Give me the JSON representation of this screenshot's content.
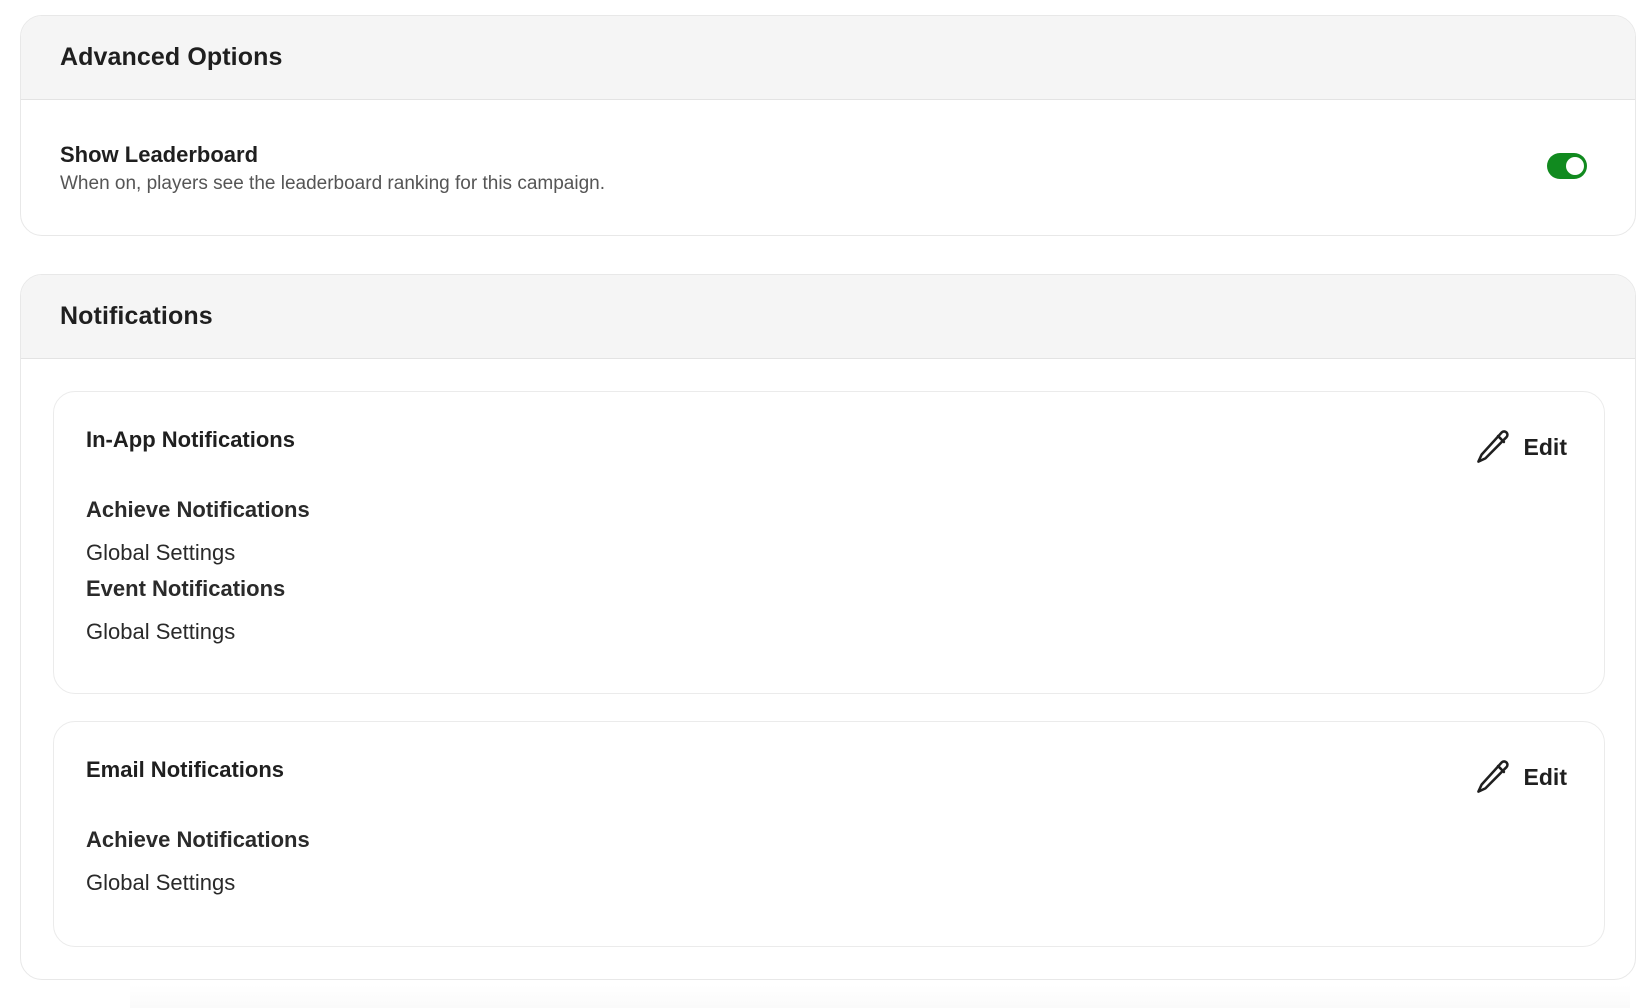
{
  "advanced": {
    "title": "Advanced Options",
    "leaderboard": {
      "title": "Show Leaderboard",
      "description": "When on, players see the leaderboard ranking for this campaign.",
      "enabled": true,
      "toggle_color": "#118a1f"
    }
  },
  "notifications": {
    "title": "Notifications",
    "in_app": {
      "title": "In-App Notifications",
      "edit_label": "Edit",
      "items": [
        {
          "name": "Achieve Notifications",
          "value": "Global Settings"
        },
        {
          "name": "Event Notifications",
          "value": "Global Settings"
        }
      ]
    },
    "email": {
      "title": "Email Notifications",
      "edit_label": "Edit",
      "items": [
        {
          "name": "Achieve Notifications",
          "value": "Global Settings"
        }
      ]
    }
  },
  "icons": {
    "edit": "pencil-icon"
  }
}
